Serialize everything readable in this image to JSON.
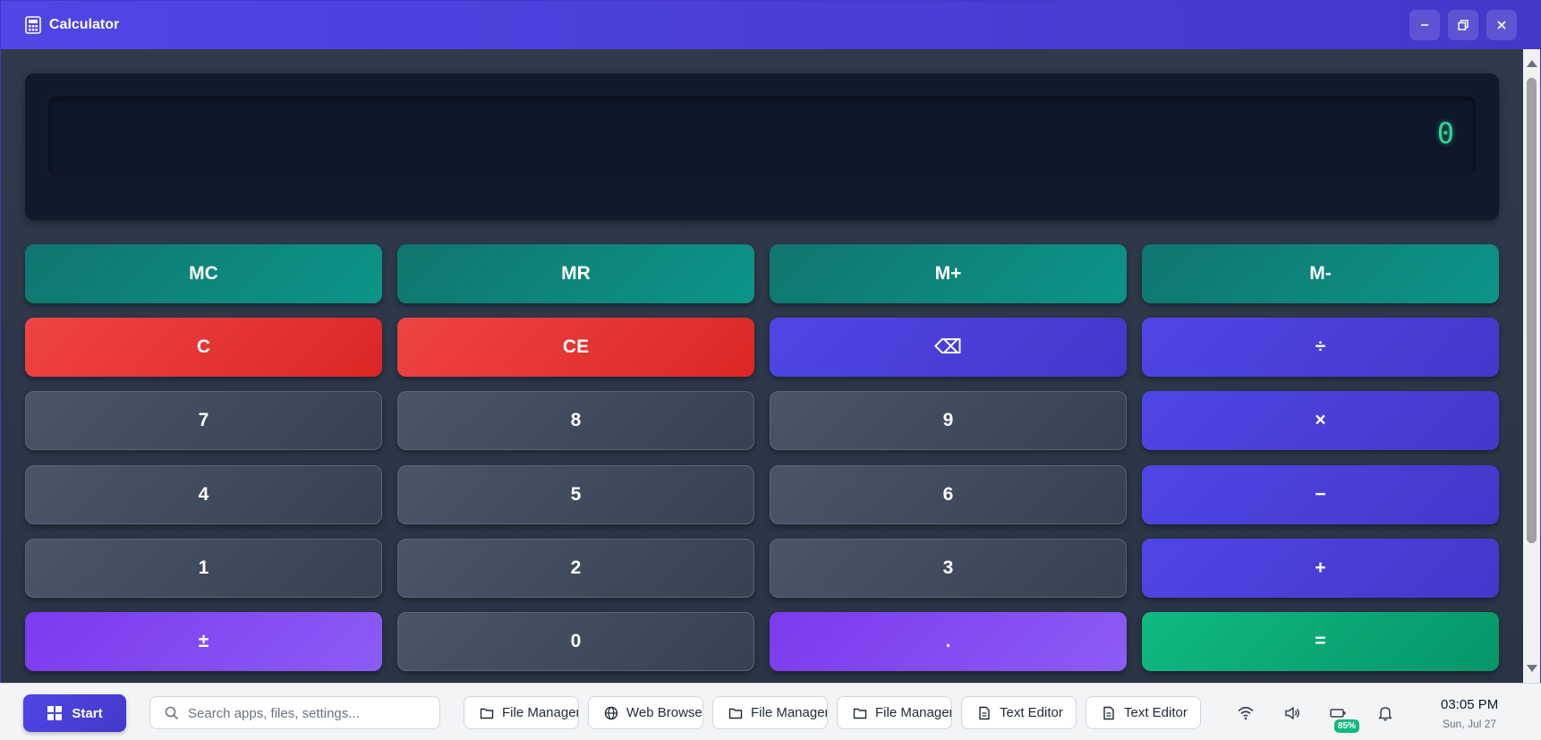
{
  "window": {
    "title": "Calculator",
    "title_icon": "calculator-icon",
    "controls": [
      "minimize-icon",
      "restore-icon",
      "close-icon"
    ]
  },
  "display": {
    "value": "0"
  },
  "keypad": {
    "rows": [
      [
        {
          "label": "MC",
          "kind": "memory"
        },
        {
          "label": "MR",
          "kind": "memory"
        },
        {
          "label": "M+",
          "kind": "memory"
        },
        {
          "label": "M-",
          "kind": "memory"
        }
      ],
      [
        {
          "label": "C",
          "kind": "clear"
        },
        {
          "label": "CE",
          "kind": "clear"
        },
        {
          "label": "⌫",
          "kind": "operator"
        },
        {
          "label": "÷",
          "kind": "operator"
        }
      ],
      [
        {
          "label": "7",
          "kind": "number"
        },
        {
          "label": "8",
          "kind": "number"
        },
        {
          "label": "9",
          "kind": "number"
        },
        {
          "label": "×",
          "kind": "operator"
        }
      ],
      [
        {
          "label": "4",
          "kind": "number"
        },
        {
          "label": "5",
          "kind": "number"
        },
        {
          "label": "6",
          "kind": "number"
        },
        {
          "label": "−",
          "kind": "operator"
        }
      ],
      [
        {
          "label": "1",
          "kind": "number"
        },
        {
          "label": "2",
          "kind": "number"
        },
        {
          "label": "3",
          "kind": "number"
        },
        {
          "label": "+",
          "kind": "operator"
        }
      ],
      [
        {
          "label": "±",
          "kind": "function"
        },
        {
          "label": "0",
          "kind": "number"
        },
        {
          "label": ".",
          "kind": "function"
        },
        {
          "label": "=",
          "kind": "equals"
        }
      ]
    ]
  },
  "taskbar": {
    "start_label": "Start",
    "search_placeholder": "Search apps, files, settings...",
    "items": [
      {
        "label": "File Manager",
        "icon": "folder-icon"
      },
      {
        "label": "Web Browser",
        "icon": "globe-icon"
      },
      {
        "label": "File Manager",
        "icon": "folder-icon"
      },
      {
        "label": "File Manager",
        "icon": "folder-icon"
      },
      {
        "label": "Text Editor",
        "icon": "document-icon"
      },
      {
        "label": "Text Editor",
        "icon": "document-icon"
      }
    ],
    "tray": {
      "icons": [
        "wifi-icon",
        "volume-icon",
        "battery-icon",
        "bell-icon"
      ],
      "battery_percent": "85%",
      "time": "03:05 PM",
      "date": "Sun, Jul 27"
    }
  },
  "colors": {
    "accent": "#4f46e5",
    "memory": "#0d9488",
    "clear": "#ef4444",
    "number": "#4a5568",
    "function": "#8b5cf6",
    "equals": "#10b981",
    "display_text": "#34d399"
  }
}
